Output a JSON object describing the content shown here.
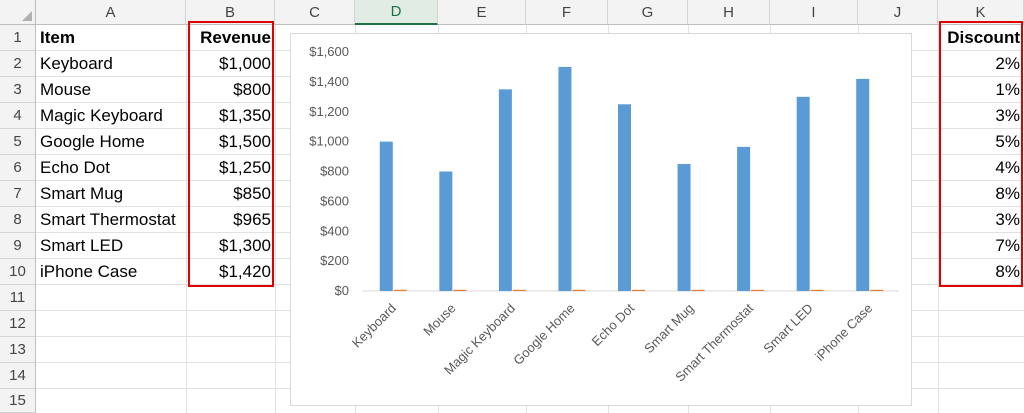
{
  "columns": [
    "A",
    "B",
    "C",
    "D",
    "E",
    "F",
    "G",
    "H",
    "I",
    "J",
    "K"
  ],
  "selected_column": "D",
  "rows": [
    "1",
    "2",
    "3",
    "4",
    "5",
    "6",
    "7",
    "8",
    "9",
    "10",
    "11",
    "12",
    "13",
    "14",
    "15"
  ],
  "headers": {
    "item": "Item",
    "revenue": "Revenue",
    "discount": "Discount"
  },
  "table": [
    {
      "item": "Keyboard",
      "revenue": "$1,000",
      "discount": "2%"
    },
    {
      "item": "Mouse",
      "revenue": "$800",
      "discount": "1%"
    },
    {
      "item": "Magic Keyboard",
      "revenue": "$1,350",
      "discount": "3%"
    },
    {
      "item": "Google Home",
      "revenue": "$1,500",
      "discount": "5%"
    },
    {
      "item": "Echo Dot",
      "revenue": "$1,250",
      "discount": "4%"
    },
    {
      "item": "Smart Mug",
      "revenue": "$850",
      "discount": "8%"
    },
    {
      "item": "Smart Thermostat",
      "revenue": "$965",
      "discount": "3%"
    },
    {
      "item": "Smart LED",
      "revenue": "$1,300",
      "discount": "7%"
    },
    {
      "item": "iPhone Case",
      "revenue": "$1,420",
      "discount": "8%"
    }
  ],
  "colors": {
    "revenue_series": "#5b9bd5",
    "discount_series": "#ed7d31",
    "highlight_border": "#e00000",
    "selected_header": "#217346"
  },
  "chart_data": {
    "type": "bar",
    "categories": [
      "Keyboard",
      "Mouse",
      "Magic Keyboard",
      "Google Home",
      "Echo Dot",
      "Smart Mug",
      "Smart Thermostat",
      "Smart LED",
      "iPhone Case"
    ],
    "series": [
      {
        "values": [
          1000,
          800,
          1350,
          1500,
          1250,
          850,
          965,
          1300,
          1420
        ]
      },
      {
        "values": [
          0.02,
          0.01,
          0.03,
          0.05,
          0.04,
          0.08,
          0.03,
          0.07,
          0.08
        ]
      }
    ],
    "ylim": [
      0,
      1600
    ],
    "yticks": [
      "$0",
      "$200",
      "$400",
      "$600",
      "$800",
      "$1,000",
      "$1,200",
      "$1,400",
      "$1,600"
    ],
    "grid": false,
    "legend": "none"
  }
}
